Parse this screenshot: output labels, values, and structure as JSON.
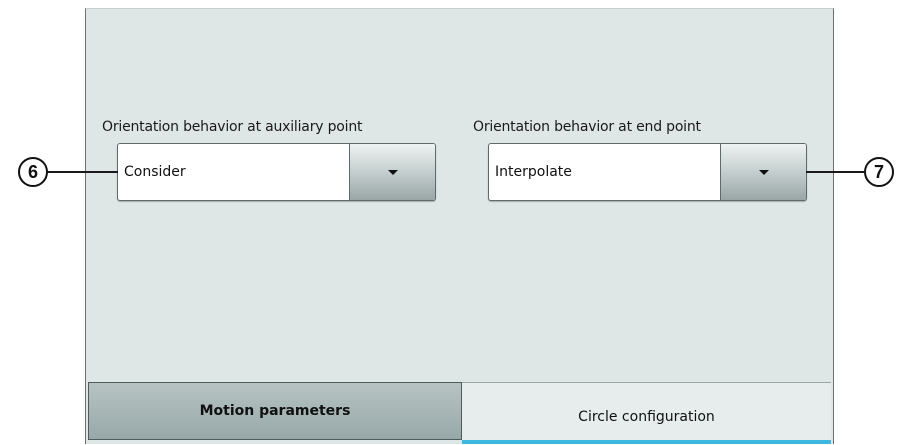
{
  "panel": {
    "aux_point": {
      "label": "Orientation behavior at auxiliary point",
      "value": "Consider",
      "callout": "6"
    },
    "end_point": {
      "label": "Orientation behavior at end point",
      "value": "Interpolate",
      "callout": "7"
    }
  },
  "tabs": [
    {
      "label": "Motion parameters",
      "selected": false
    },
    {
      "label": "Circle configuration",
      "selected": true
    }
  ],
  "colors": {
    "panel_background": "#dfe6e6",
    "active_tab_indicator": "#3fb8e0",
    "inactive_tab": "#a7b5b5"
  },
  "icons": {
    "dropdown_arrow": "caret-down-icon"
  }
}
